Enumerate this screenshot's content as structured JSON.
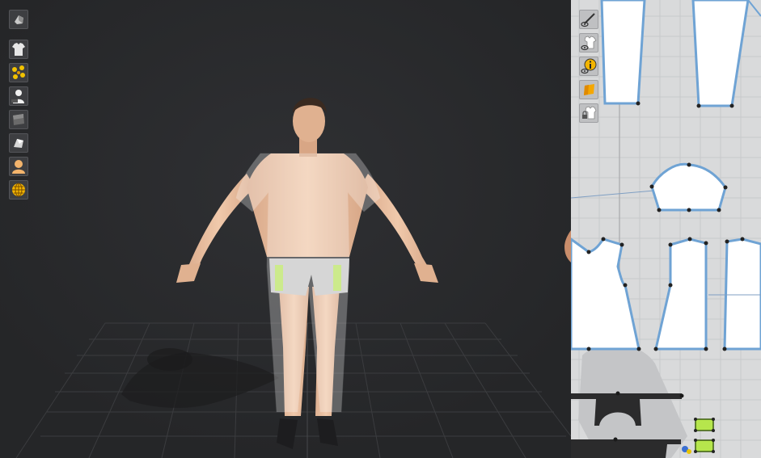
{
  "app": {
    "title": ""
  },
  "viewport_3d": {
    "toolbar": [
      {
        "icon": "avatar-display-icon"
      },
      {
        "icon": "garment-display-icon"
      },
      {
        "icon": "points-display-icon"
      },
      {
        "icon": "avatar-measure-icon"
      },
      {
        "icon": "texture-solid-icon"
      },
      {
        "icon": "texture-shaded-icon"
      },
      {
        "icon": "avatar-skin-icon"
      },
      {
        "icon": "globe-render-icon"
      }
    ],
    "colors": {
      "background": "#28292b",
      "grid": "#3a3b3e",
      "skin": "#e3b896",
      "highlight": "#b6e64c"
    }
  },
  "viewport_2d": {
    "toolbar": [
      {
        "icon": "needle-visibility-icon"
      },
      {
        "icon": "shirt-visibility-icon"
      },
      {
        "icon": "info-visibility-icon"
      },
      {
        "icon": "fabric-color-icon"
      },
      {
        "icon": "lock-garment-icon"
      }
    ],
    "colors": {
      "background": "#d9dadb",
      "pattern_fill": "#ffffff",
      "pattern_outline": "#6fa3d4",
      "selected": "#b6e64c"
    }
  }
}
